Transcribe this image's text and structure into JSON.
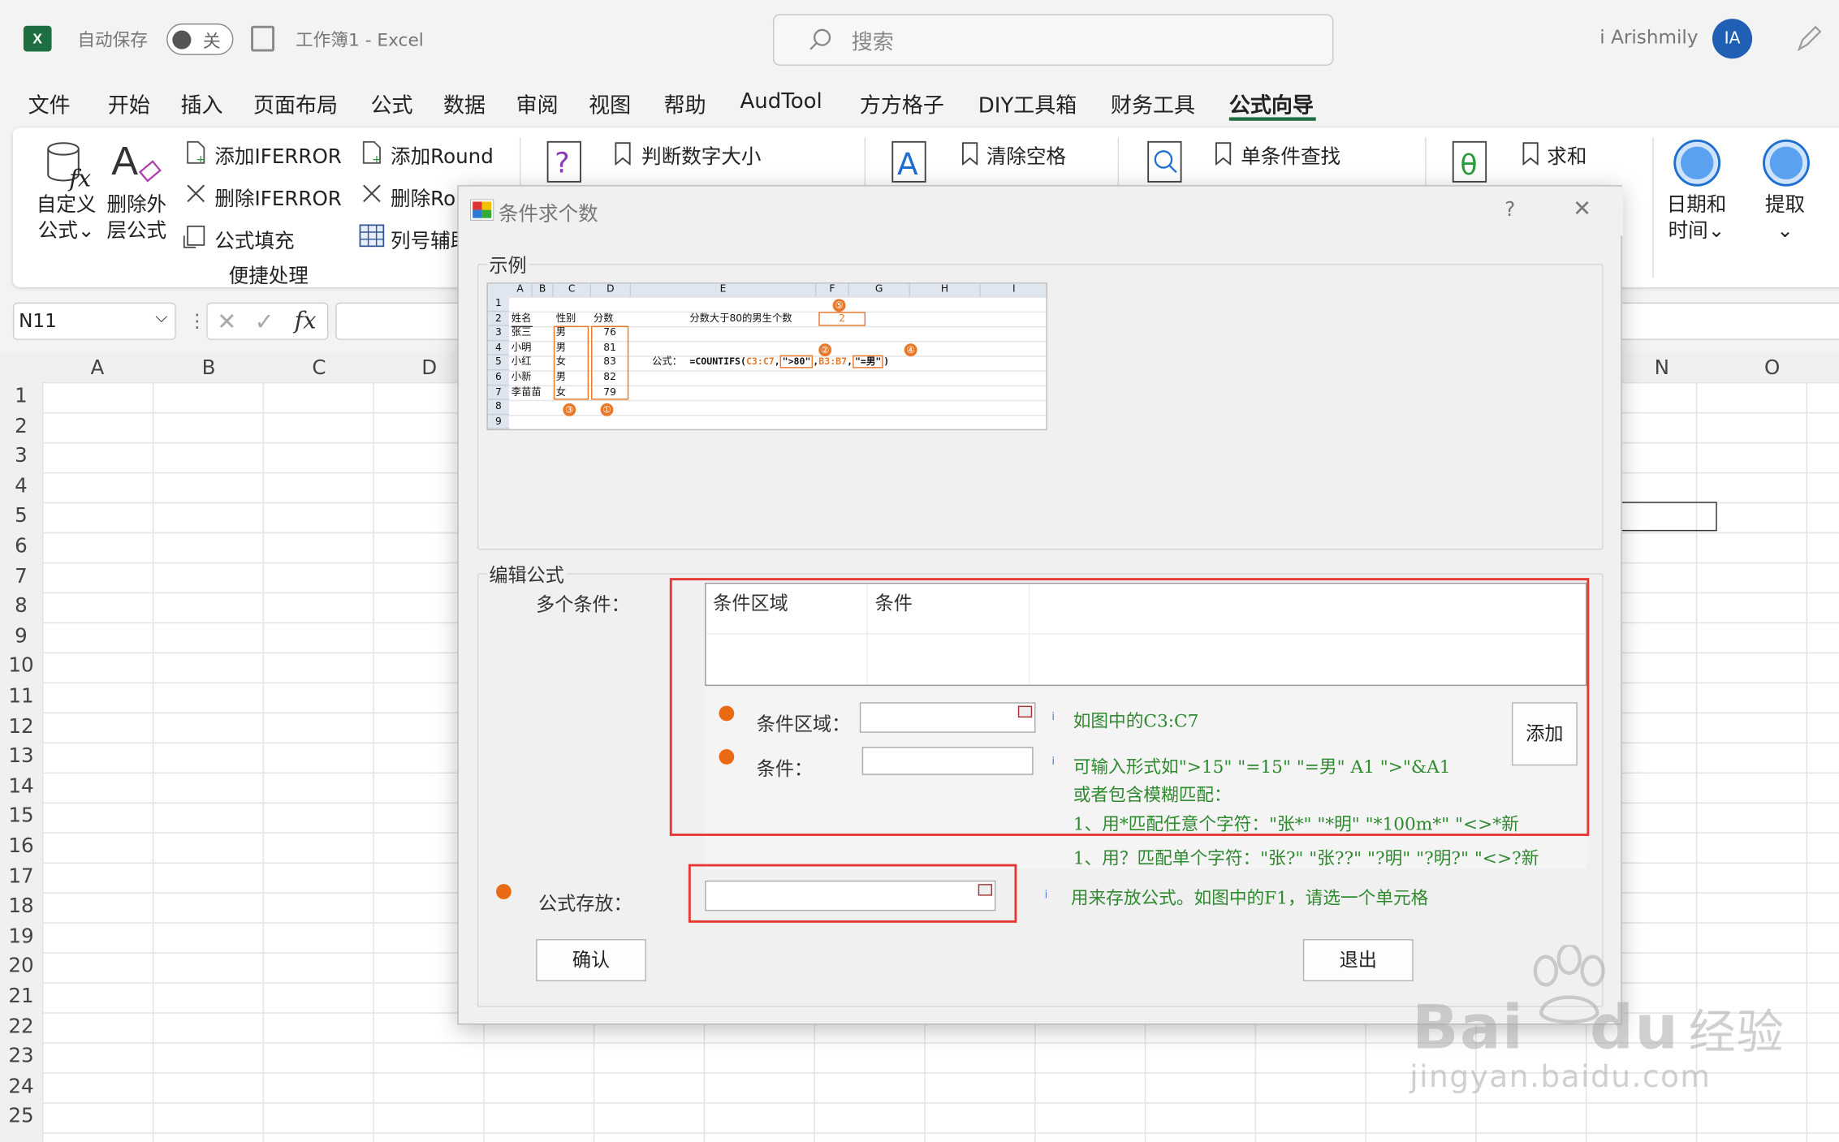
{
  "app": {
    "autosave_label": "自动保存",
    "autosave_state": "关",
    "doc_title": "工作簿1  -  Excel",
    "search_placeholder": "搜索",
    "user_name": "i Arishmily",
    "user_initials": "IA"
  },
  "menu": {
    "tabs": [
      "文件",
      "开始",
      "插入",
      "页面布局",
      "公式",
      "数据",
      "审阅",
      "视图",
      "帮助",
      "AudTool",
      "方方格子",
      "DIY工具箱",
      "财务工具",
      "公式向导"
    ],
    "active_tab": "公式向导"
  },
  "ribbon": {
    "custom_formula": "自定义\n公式",
    "custom_formula_line1": "自定义",
    "custom_formula_line2": "公式",
    "delete_outer_line1": "删除外",
    "delete_outer_line2": "层公式",
    "add_iferror": "添加IFERROR",
    "delete_iferror": "删除IFERROR",
    "formula_fill": "公式填充",
    "add_round": "添加Round",
    "delete_round": "删除Ro",
    "column_aux": "列号辅助",
    "group_quick": "便捷处理",
    "judge_number": "判断数字大小",
    "clear_spaces": "清除空格",
    "single_lookup": "单条件查找",
    "sum": "求和",
    "date_time_line1": "日期和",
    "date_time_line2": "时间",
    "extract": "提取"
  },
  "formula_bar": {
    "name_box": "N11",
    "fx": "fx"
  },
  "sheet": {
    "columns": [
      "A",
      "B",
      "C",
      "D",
      "N",
      "O"
    ],
    "rows": [
      "1",
      "2",
      "3",
      "4",
      "5",
      "6",
      "7",
      "8",
      "9",
      "10",
      "11",
      "12",
      "13",
      "14",
      "15",
      "16",
      "17",
      "18",
      "19",
      "20",
      "21",
      "22",
      "23",
      "24",
      "25"
    ]
  },
  "dialog": {
    "title": "条件求个数",
    "help": "?",
    "close": "✕",
    "example_group": "示例",
    "example_sheet": {
      "col_headers": [
        "A",
        "B",
        "C",
        "D",
        "E",
        "F",
        "G",
        "H",
        "I"
      ],
      "row_headers": [
        "1",
        "2",
        "3",
        "4",
        "5",
        "6",
        "7",
        "8",
        "9"
      ],
      "header_name": "姓名",
      "header_gender": "性别",
      "header_score": "分数",
      "names": [
        "张三",
        "小明",
        "小红",
        "小新",
        "李苗苗"
      ],
      "genders": [
        "男",
        "男",
        "女",
        "男",
        "女"
      ],
      "scores": [
        "76",
        "81",
        "83",
        "82",
        "79"
      ],
      "question": "分数大于80的男生个数",
      "answer": "2",
      "formula_label": "公式：",
      "formula_prefix": "=COUNTIFS(",
      "formula_range1": "C3:C7",
      "formula_cond1": "\">80\"",
      "formula_range2": "B3:B7",
      "formula_cond2": "\"=男\"",
      "formula_suffix": ")",
      "markers": [
        "①",
        "②",
        "③",
        "④",
        "⑤"
      ]
    },
    "edit_group": "编辑公式",
    "multi_cond_label": "多个条件：",
    "list_headers": [
      "条件区域",
      "条件"
    ],
    "cond_range_label": "条件区域：",
    "cond_label": "条件：",
    "hint_range": "如图中的C3:C7",
    "hint_cond1": "可输入形式如\">15\"  \"=15\"  \"=男\"  A1  \">\"&A1",
    "hint_cond2": "或者包含模糊匹配：",
    "hint_cond3": "1、用*匹配任意个字符：\"张*\"  \"*明\"  \"*100m*\"  \"<>*新",
    "hint_cond4": "1、用？匹配单个字符：\"张?\" \"张??\" \"?明\" \"?明?\" \"<>?新",
    "add_button": "添加",
    "store_label": "公式存放：",
    "hint_store": "用来存放公式。如图中的F1，请选一个单元格",
    "ok_button": "确认",
    "exit_button": "退出"
  },
  "watermark": {
    "logo": "Bai",
    "logo2": "du",
    "jingyan": "经验",
    "url": "jingyan.baidu.com"
  }
}
